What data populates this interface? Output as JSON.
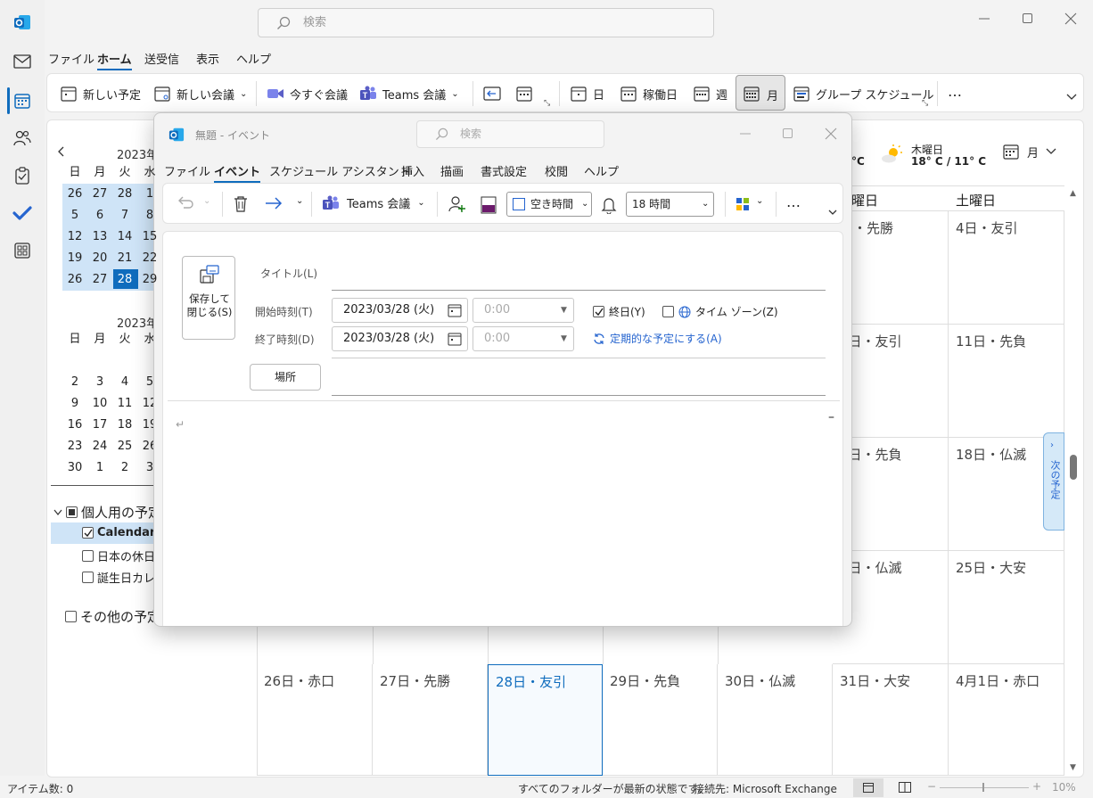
{
  "titlebar": {
    "search_placeholder": "検索"
  },
  "menu": {
    "items": [
      "ファイル",
      "ホーム",
      "送受信",
      "表示",
      "ヘルプ"
    ]
  },
  "ribbon": {
    "new_appointment": "新しい予定",
    "new_meeting": "新しい会議",
    "meet_now": "今すぐ会議",
    "teams_meeting": "Teams 会議",
    "day": "日",
    "work_week": "稼働日",
    "week": "週",
    "month": "月",
    "group_schedule": "グループ スケジュール",
    "more": "…"
  },
  "weather": {
    "temp_left": "°C",
    "day": "木曜日",
    "temp": "18° C / 11° C",
    "view": "月"
  },
  "minical1": {
    "title": "2023年",
    "weekdays": [
      "日",
      "月",
      "火",
      "水"
    ],
    "rows": [
      [
        "26",
        "27",
        "28",
        "1"
      ],
      [
        "5",
        "6",
        "7",
        "8"
      ],
      [
        "12",
        "13",
        "14",
        "15"
      ],
      [
        "19",
        "20",
        "21",
        "22"
      ],
      [
        "26",
        "27",
        "28",
        "29"
      ]
    ]
  },
  "minical2": {
    "title": "2023年",
    "weekdays": [
      "日",
      "月",
      "火",
      "水"
    ],
    "rows": [
      [
        "2",
        "3",
        "4",
        "5"
      ],
      [
        "9",
        "10",
        "11",
        "12"
      ],
      [
        "16",
        "17",
        "18",
        "19"
      ],
      [
        "23",
        "24",
        "25",
        "26"
      ],
      [
        "30",
        "1",
        "2",
        "3"
      ]
    ]
  },
  "folders": {
    "group": "個人用の予定",
    "items": [
      "Calendar",
      "日本の休日",
      "誕生日カレンダー"
    ],
    "other": "その他の予定"
  },
  "grid": {
    "headers": [
      "曜日",
      "土曜日"
    ],
    "rows": [
      [
        "日・先勝",
        "4日・友引"
      ],
      [
        "0日・友引",
        "11日・先負"
      ],
      [
        "7日・先負",
        "18日・仏滅"
      ],
      [
        "4日・仏滅",
        "25日・大安"
      ]
    ],
    "last_row": [
      "26日・赤口",
      "27日・先勝",
      "28日・友引",
      "29日・先負",
      "30日・仏滅",
      "31日・大安",
      "4月1日・赤口"
    ]
  },
  "side_tab": "次の予定",
  "status": {
    "items": "アイテム数: 0",
    "sync": "すべてのフォルダーが最新の状態です。",
    "connection": "接続先: Microsoft Exchange",
    "zoom": "10%"
  },
  "dialog": {
    "title": "無題 - イベント",
    "search_placeholder": "検索",
    "tabs": [
      "ファイル",
      "イベント",
      "スケジュール アシスタント",
      "挿入",
      "描画",
      "書式設定",
      "校閲",
      "ヘルプ"
    ],
    "ribbon": {
      "teams": "Teams 会議",
      "show_as": "空き時間",
      "reminder": "18 時間",
      "more": "…"
    },
    "save_close": "保存して閉じる(S)",
    "title_label": "タイトル(L)",
    "start_label": "開始時刻(T)",
    "end_label": "終了時刻(D)",
    "start_date": "2023/03/28 (火)",
    "end_date": "2023/03/28 (火)",
    "start_time": "0:00",
    "end_time": "0:00",
    "all_day": "終日(Y)",
    "timezone": "タイム ゾーン(Z)",
    "recurring": "定期的な予定にする(A)",
    "location_button": "場所",
    "body_mark": "↵"
  }
}
